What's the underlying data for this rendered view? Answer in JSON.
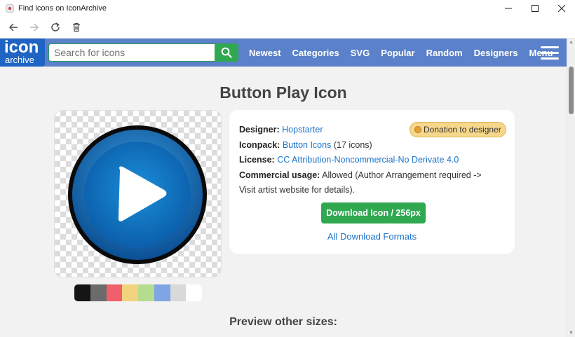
{
  "window": {
    "title": "Find icons on IconArchive"
  },
  "site": {
    "logo_line1": "icon",
    "logo_line2": "archive",
    "search_placeholder": "Search for icons",
    "nav": [
      "Newest",
      "Categories",
      "SVG",
      "Popular",
      "Random",
      "Designers",
      "Menu"
    ]
  },
  "page": {
    "title": "Button Play Icon",
    "details": {
      "designer_label": "Designer:",
      "designer": "Hopstarter",
      "iconpack_label": "Iconpack:",
      "iconpack": "Button Icons",
      "iconpack_count": "(17 icons)",
      "license_label": "License:",
      "license": "CC Attribution-Noncommercial-No Derivate 4.0",
      "commercial_label": "Commercial usage:",
      "commercial_line1": "Allowed (Author Arrangement required ->",
      "commercial_line2": "Visit artist website for details)."
    },
    "donation": "Donation to designer",
    "download_button": "Download Icon / 256px",
    "all_formats": "All Download Formats",
    "preview_heading": "Preview other sizes:"
  },
  "swatch_colors": [
    "#151515",
    "#6b6b6b",
    "#f25f6c",
    "#f2d37e",
    "#b5dd8d",
    "#7ea6e4",
    "#d9d9d9",
    "#ffffff"
  ],
  "icons": {
    "back": "arrow-left-icon",
    "forward": "arrow-right-icon",
    "reload": "reload-icon",
    "delete": "trash-icon",
    "search": "search-icon",
    "menu": "hamburger-icon"
  }
}
